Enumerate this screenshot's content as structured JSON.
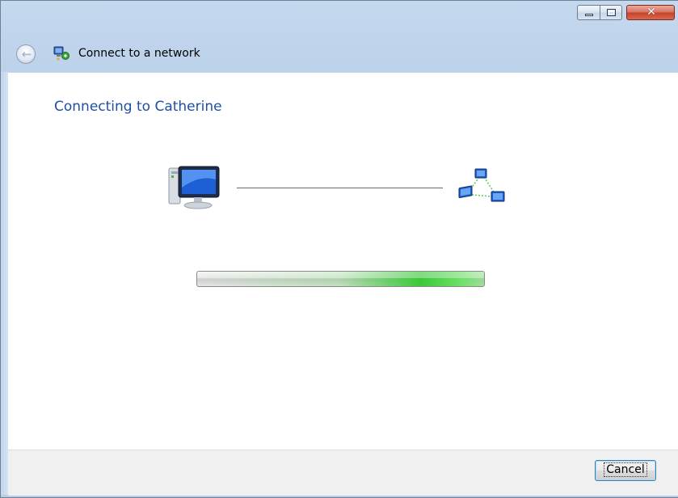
{
  "window": {
    "title": "Connect to a network",
    "controls": {
      "minimize_icon": "minimize-icon",
      "maximize_icon": "maximize-icon",
      "close_icon": "close-icon",
      "close_glyph": "✕"
    }
  },
  "nav": {
    "back_icon": "back-arrow-icon",
    "back_glyph": "←",
    "title_icon": "network-connection-icon"
  },
  "main": {
    "heading": "Connecting to Catherine",
    "left_icon": "computer-icon",
    "right_icon": "network-icon",
    "progress": {
      "status": "indeterminate",
      "fill_fraction": 1.0,
      "accent_color": "#3bc83a"
    }
  },
  "footer": {
    "cancel_label": "Cancel"
  },
  "colors": {
    "heading": "#1f4fa5",
    "chrome": "#bcd2ea",
    "footer": "#f0f0f0"
  }
}
